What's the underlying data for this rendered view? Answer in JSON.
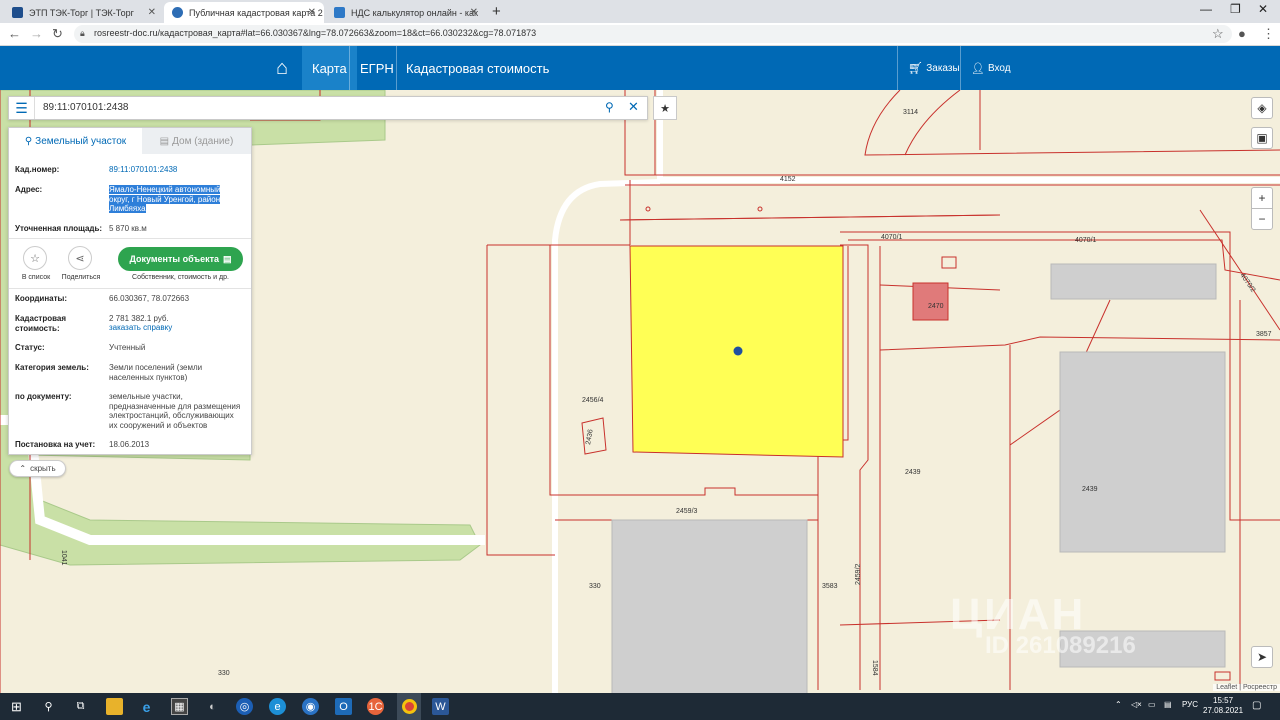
{
  "browser": {
    "tabs": [
      {
        "title": "ЭТП ТЭК-Торг | ТЭК-Торг",
        "color": "#1f4e8c"
      },
      {
        "title": "Публичная кадастровая карта 2",
        "color": "#2d6db5"
      },
      {
        "title": "НДС калькулятор онлайн - как",
        "color": "#2e79c7"
      }
    ],
    "new_tab": "+",
    "url": "rosreestr-doc.ru/кадастровая_карта#lat=66.030367&lng=78.072663&zoom=18&ct=66.030232&cg=78.071873"
  },
  "header": {
    "home_icon": "home-icon",
    "nav": [
      "Карта",
      "ЕГРН",
      "Кадастровая стоимость"
    ],
    "orders": "Заказы",
    "login": "Вход"
  },
  "search": {
    "value": "89:11:070101:2438"
  },
  "panel": {
    "tab_land": "Земельный участок",
    "tab_house": "Дом (здание)",
    "cad_label": "Кад.номер:",
    "cad_value": "89:11:070101:2438",
    "address_label": "Адрес:",
    "address_value": "Ямало-Ненецкий автономный округ, г Новый Уренгой, район Лимбяяха",
    "area_label": "Уточненная площадь:",
    "area_value": "5 870 кв.м",
    "to_list": "В список",
    "share": "Поделиться",
    "docs_button": "Документы объекта",
    "docs_sub": "Собственник, стоимость и др.",
    "coords_label": "Координаты:",
    "coords_value": "66.030367, 78.072663",
    "cost_label": "Кадастровая стоимость:",
    "cost_value": "2 781 382.1 руб.",
    "cost_link": "заказать справку",
    "status_label": "Статус:",
    "status_value": "Учтенный",
    "category_label": "Категория земель:",
    "category_value": "Земли поселений (земли населенных пунктов)",
    "doc_label": "по документу:",
    "doc_value": "земельные участки, предназначенные для размещения электростанций, обслуживающих их сооружений и объектов",
    "reg_label": "Постановка на учет:",
    "reg_value": "18.06.2013",
    "hide": "скрыть"
  },
  "map_labels": {
    "l3114": "3114",
    "l4152": "4152",
    "l4070_1a": "4070/1",
    "l4070_1b": "4070/1",
    "l4070_2": "4070/2",
    "l3857": "3857",
    "l2470": "2470",
    "l2456_4": "2456/4",
    "l2436": "2436",
    "l2439a": "2439",
    "l2439b": "2439",
    "l2459_3": "2459/3",
    "l2459_2": "2459/2",
    "l3583": "3583",
    "l330a": "330",
    "l330b": "330",
    "l1041": "1041",
    "l1584": "1584"
  },
  "attribution": "Leaflet | Росреестр",
  "watermark": "ЦИАН",
  "watermark_id": "ID 261089216",
  "taskbar": {
    "lang": "РУС",
    "time": "15:57",
    "date": "27.08.2021"
  },
  "colors": {
    "brand": "#0069b5",
    "parcel_fill": "#ffff55",
    "boundary": "#c8312c",
    "green": "#b9d68e"
  }
}
